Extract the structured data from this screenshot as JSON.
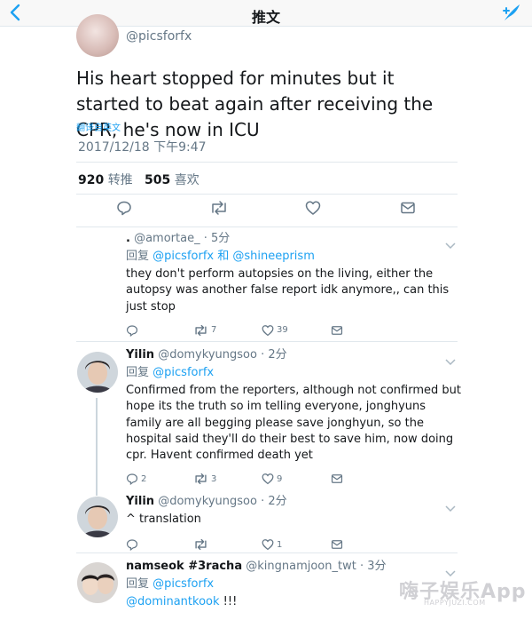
{
  "nav": {
    "title": "推文"
  },
  "main_tweet": {
    "handle": "@picsforfx",
    "text": "His heart stopped for minutes but it started to beat again after receiving the CPR, he's now in ICU",
    "translate_label": "翻译自英文",
    "timestamp": "2017/12/18 下午9:47",
    "retweets_count": "920",
    "retweets_label": "转推",
    "likes_count": "505",
    "likes_label": "喜欢"
  },
  "replies": [
    {
      "name": ".",
      "handle": "@amortae_",
      "time": "5分",
      "reply_prefix": "回复",
      "reply_to": "@picsforfx 和 @shineeprism",
      "text": "they don't perform autopsies on the living, either the autopsy was another false report idk anymore,, can this just stop",
      "retweets": "7",
      "likes": "39"
    },
    {
      "name": "Yilin",
      "handle": "@domykyungsoo",
      "time": "2分",
      "reply_prefix": "回复",
      "reply_to": "@picsforfx",
      "text": "Confirmed from the reporters, although not confirmed but hope its the truth so im telling everyone, jonghyuns family are all begging please save jonghyun, so the hospital said they'll do their best to save him, now doing cpr. Havent confirmed death yet",
      "replies": "2",
      "retweets": "3",
      "likes": "9"
    },
    {
      "name": "Yilin",
      "handle": "@domykyungsoo",
      "time": "2分",
      "text": "^ translation",
      "likes": "1"
    },
    {
      "name": "namseok #3racha",
      "handle": "@kingnamjoon_twt",
      "time": "3分",
      "reply_prefix": "回复",
      "reply_to": "@picsforfx",
      "text_link": "@dominantkook",
      "text_rest": "!!!"
    }
  ],
  "watermark": {
    "text": "嗨子娱乐App",
    "sub": "HAPPYJUZI.COM"
  },
  "colors": {
    "accent": "#1da1f2",
    "secondary_text": "#657786",
    "divider": "#e1e8ed"
  }
}
